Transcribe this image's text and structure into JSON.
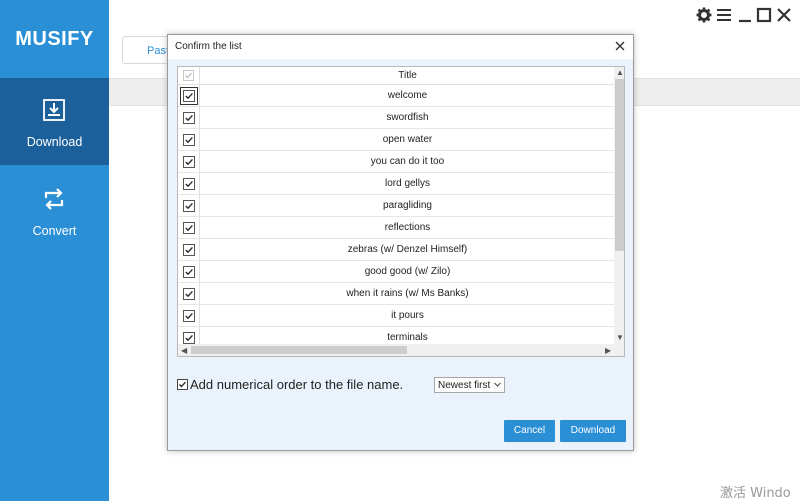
{
  "app": {
    "logo": "MUSIFY",
    "sidebar": {
      "items": [
        {
          "label": "Download",
          "icon": "download-icon",
          "active": true
        },
        {
          "label": "Convert",
          "icon": "convert-icon",
          "active": false
        }
      ]
    },
    "main": {
      "paste_label": "Paste"
    },
    "window_controls": [
      "gear-icon",
      "menu-icon",
      "minimize-icon",
      "maximize-icon",
      "close-icon"
    ],
    "watermark": "激活 Windo"
  },
  "dialog": {
    "title": "Confirm the list",
    "column_header": "Title",
    "tracks": [
      {
        "title": "welcome",
        "checked": true
      },
      {
        "title": "swordfish",
        "checked": true
      },
      {
        "title": "open water",
        "checked": true
      },
      {
        "title": "you can do it too",
        "checked": true
      },
      {
        "title": "lord gellys",
        "checked": true
      },
      {
        "title": "paragliding",
        "checked": true
      },
      {
        "title": "reflections",
        "checked": true
      },
      {
        "title": "zebras (w/ Denzel Himself)",
        "checked": true
      },
      {
        "title": "good good (w/ Zilo)",
        "checked": true
      },
      {
        "title": "when it rains (w/ Ms Banks)",
        "checked": true
      },
      {
        "title": "it pours",
        "checked": true
      },
      {
        "title": "terminals",
        "checked": true
      }
    ],
    "order_option": {
      "label": "Add numerical order to the file name.",
      "checked": true
    },
    "order_select": {
      "value": "Newest first"
    },
    "cancel_label": "Cancel",
    "download_label": "Download"
  },
  "colors": {
    "brand": "#2b8fd6",
    "sidebar_active": "#1b5f9b",
    "dialog_bg": "#eaf3fb"
  }
}
